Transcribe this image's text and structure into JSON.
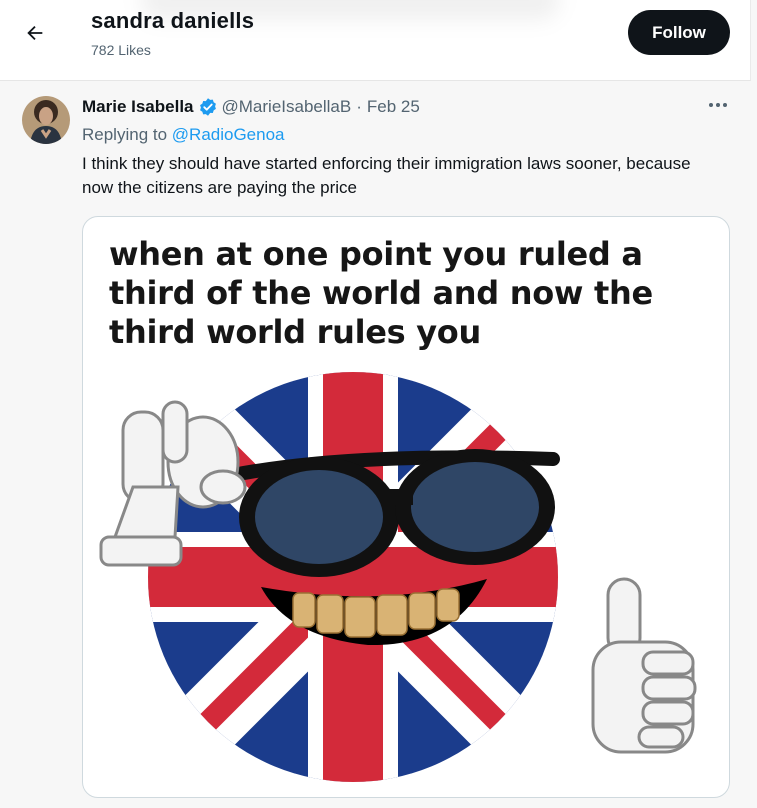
{
  "header": {
    "title": "sandra daniells",
    "likes": "782 Likes",
    "follow_label": "Follow",
    "back_icon": "arrow-left-icon"
  },
  "tweet": {
    "author_name": "Marie Isabella",
    "verified_icon": "verified-badge-icon",
    "handle": "@MarieIsabellaB",
    "separator": "·",
    "date": "Feb 25",
    "more_icon": "more-horizontal-icon",
    "replying_prefix": "Replying to ",
    "replying_to": "@RadioGenoa",
    "text": "I think they should have started enforcing their immigration laws sooner, because now the citizens are paying the price",
    "media": {
      "caption": "when at one point you ruled a third of the world and now the third world rules you"
    }
  },
  "colors": {
    "accent": "#1d9bf0",
    "follow_bg": "#0f1419",
    "union_blue": "#1b3c8c",
    "union_red": "#d32a3a"
  }
}
